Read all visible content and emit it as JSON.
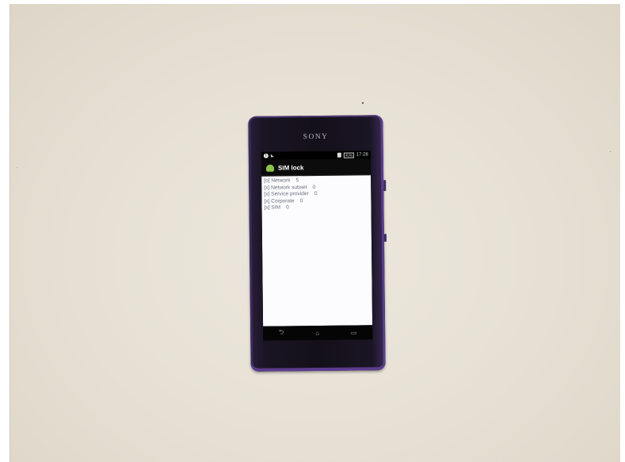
{
  "phone": {
    "brand": "SONY",
    "status_bar": {
      "battery_percent": "40%",
      "time": "17:28"
    },
    "app": {
      "title": "SIM lock",
      "icon": "android-icon",
      "lock_rows": [
        {
          "state": "[o]",
          "label": "Network",
          "value": "5"
        },
        {
          "state": "[x]",
          "label": "Network subset",
          "value": "0"
        },
        {
          "state": "[x]",
          "label": "Service provider",
          "value": "0"
        },
        {
          "state": "[x]",
          "label": "Corporate",
          "value": "0"
        },
        {
          "state": "[x]",
          "label": "SIM",
          "value": "0"
        }
      ]
    },
    "nav_bar": {
      "back": "back-icon",
      "home": "home-icon",
      "recents": "recents-icon"
    }
  },
  "colors": {
    "background": "#e6e0d4",
    "phone_body": "#141019",
    "phone_rim": "#5b3c8c",
    "screen_content": "#fcfcff",
    "content_text": "#6a6f7a"
  }
}
